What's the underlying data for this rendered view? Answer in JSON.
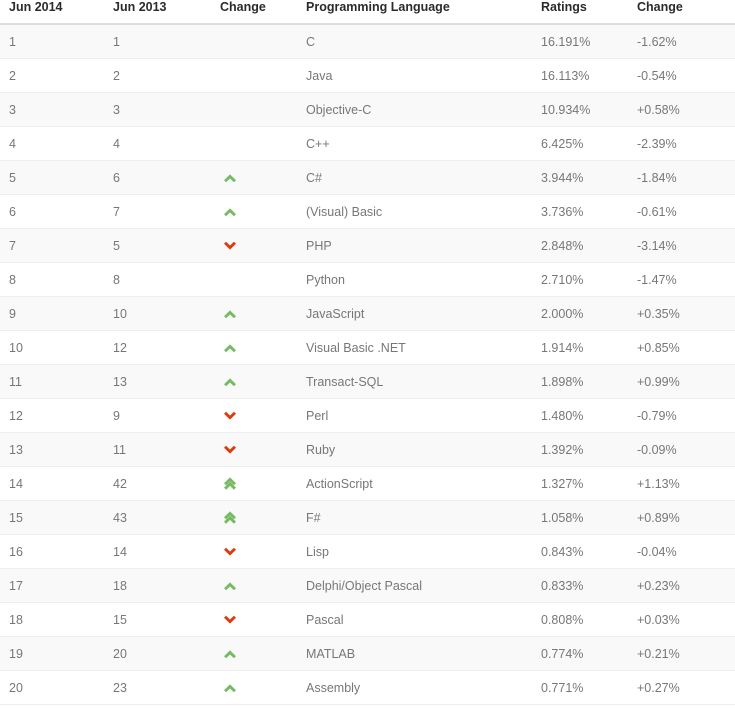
{
  "table": {
    "headers": {
      "rank_current": "Jun 2014",
      "rank_previous": "Jun 2013",
      "change_icon": "Change",
      "language": "Programming Language",
      "ratings": "Ratings",
      "change_pct": "Change"
    },
    "colors": {
      "up": "#76bb64",
      "down": "#dd3c10",
      "header_text": "#2b2b2b",
      "body_text": "#777777",
      "row_alt_bg": "#f9f9f9",
      "row_bg": "#ffffff",
      "row_border": "#eeeeee",
      "header_border": "#dddddd"
    },
    "rows": [
      {
        "rank_current": "1",
        "rank_previous": "1",
        "change_icon": "none",
        "language": "C",
        "ratings": "16.191%",
        "change_pct": "-1.62%"
      },
      {
        "rank_current": "2",
        "rank_previous": "2",
        "change_icon": "none",
        "language": "Java",
        "ratings": "16.113%",
        "change_pct": "-0.54%"
      },
      {
        "rank_current": "3",
        "rank_previous": "3",
        "change_icon": "none",
        "language": "Objective-C",
        "ratings": "10.934%",
        "change_pct": "+0.58%"
      },
      {
        "rank_current": "4",
        "rank_previous": "4",
        "change_icon": "none",
        "language": "C++",
        "ratings": "6.425%",
        "change_pct": "-2.39%"
      },
      {
        "rank_current": "5",
        "rank_previous": "6",
        "change_icon": "chevron-up",
        "language": "C#",
        "ratings": "3.944%",
        "change_pct": "-1.84%"
      },
      {
        "rank_current": "6",
        "rank_previous": "7",
        "change_icon": "chevron-up",
        "language": "(Visual) Basic",
        "ratings": "3.736%",
        "change_pct": "-0.61%"
      },
      {
        "rank_current": "7",
        "rank_previous": "5",
        "change_icon": "chevron-down",
        "language": "PHP",
        "ratings": "2.848%",
        "change_pct": "-3.14%"
      },
      {
        "rank_current": "8",
        "rank_previous": "8",
        "change_icon": "none",
        "language": "Python",
        "ratings": "2.710%",
        "change_pct": "-1.47%"
      },
      {
        "rank_current": "9",
        "rank_previous": "10",
        "change_icon": "chevron-up",
        "language": "JavaScript",
        "ratings": "2.000%",
        "change_pct": "+0.35%"
      },
      {
        "rank_current": "10",
        "rank_previous": "12",
        "change_icon": "chevron-up",
        "language": "Visual Basic .NET",
        "ratings": "1.914%",
        "change_pct": "+0.85%"
      },
      {
        "rank_current": "11",
        "rank_previous": "13",
        "change_icon": "chevron-up",
        "language": "Transact-SQL",
        "ratings": "1.898%",
        "change_pct": "+0.99%"
      },
      {
        "rank_current": "12",
        "rank_previous": "9",
        "change_icon": "chevron-down",
        "language": "Perl",
        "ratings": "1.480%",
        "change_pct": "-0.79%"
      },
      {
        "rank_current": "13",
        "rank_previous": "11",
        "change_icon": "chevron-down",
        "language": "Ruby",
        "ratings": "1.392%",
        "change_pct": "-0.09%"
      },
      {
        "rank_current": "14",
        "rank_previous": "42",
        "change_icon": "double-chevron-up",
        "language": "ActionScript",
        "ratings": "1.327%",
        "change_pct": "+1.13%"
      },
      {
        "rank_current": "15",
        "rank_previous": "43",
        "change_icon": "double-chevron-up",
        "language": "F#",
        "ratings": "1.058%",
        "change_pct": "+0.89%"
      },
      {
        "rank_current": "16",
        "rank_previous": "14",
        "change_icon": "chevron-down",
        "language": "Lisp",
        "ratings": "0.843%",
        "change_pct": "-0.04%"
      },
      {
        "rank_current": "17",
        "rank_previous": "18",
        "change_icon": "chevron-up",
        "language": "Delphi/Object Pascal",
        "ratings": "0.833%",
        "change_pct": "+0.23%"
      },
      {
        "rank_current": "18",
        "rank_previous": "15",
        "change_icon": "chevron-down",
        "language": "Pascal",
        "ratings": "0.808%",
        "change_pct": "+0.03%"
      },
      {
        "rank_current": "19",
        "rank_previous": "20",
        "change_icon": "chevron-up",
        "language": "MATLAB",
        "ratings": "0.774%",
        "change_pct": "+0.21%"
      },
      {
        "rank_current": "20",
        "rank_previous": "23",
        "change_icon": "chevron-up",
        "language": "Assembly",
        "ratings": "0.771%",
        "change_pct": "+0.27%"
      }
    ]
  }
}
